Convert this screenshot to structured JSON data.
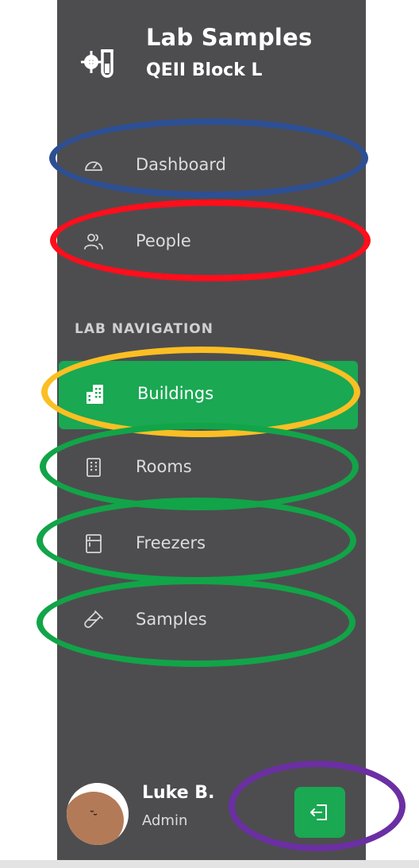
{
  "brand": {
    "title": "Lab Samples",
    "subtitle": "QEII Block L",
    "icon": "lab-sample-tube-icon"
  },
  "nav": {
    "primary": [
      {
        "id": "dashboard",
        "label": "Dashboard",
        "icon": "gauge-icon"
      },
      {
        "id": "people",
        "label": "People",
        "icon": "users-icon"
      }
    ],
    "section_title": "LAB NAVIGATION",
    "lab": [
      {
        "id": "buildings",
        "label": "Buildings",
        "icon": "building-icon",
        "active": true
      },
      {
        "id": "rooms",
        "label": "Rooms",
        "icon": "room-icon"
      },
      {
        "id": "freezers",
        "label": "Freezers",
        "icon": "freezer-icon"
      },
      {
        "id": "samples",
        "label": "Samples",
        "icon": "test-tube-icon"
      }
    ]
  },
  "user": {
    "name": "Luke B.",
    "role": "Admin"
  },
  "logout": {
    "icon": "logout-icon"
  },
  "colors": {
    "sidebar_bg": "#4d4d4f",
    "accent": "#1aa852",
    "highlight_dashboard": "#2d4f94",
    "highlight_people": "#ff0e1c",
    "highlight_buildings": "#fbbf24",
    "highlight_lab_items": "#12a448",
    "highlight_logout": "#6b2fa3"
  }
}
